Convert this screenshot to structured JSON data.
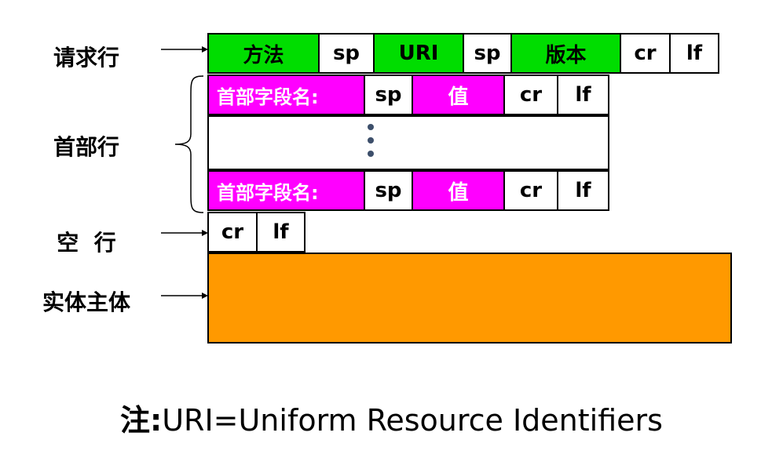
{
  "labels": {
    "request_line": "请求行",
    "header_lines": "首部行",
    "blank_line": "空  行",
    "entity_body": "实体主体"
  },
  "request_line": [
    "方法",
    "sp",
    "URI",
    "sp",
    "版本",
    "cr",
    "lf"
  ],
  "header_line_1": [
    "首部字段名:",
    "sp",
    "值",
    "cr",
    "lf"
  ],
  "header_line_2": [
    "首部字段名:",
    "sp",
    "值",
    "cr",
    "lf"
  ],
  "blank_line": [
    "cr",
    "lf"
  ],
  "note": {
    "prefix": "注:",
    "text": "URI=Uniform Resource Identifiers"
  },
  "colors": {
    "request_field": "#00dd00",
    "header_field": "#ff00ff",
    "entity_body": "#ff9900"
  }
}
